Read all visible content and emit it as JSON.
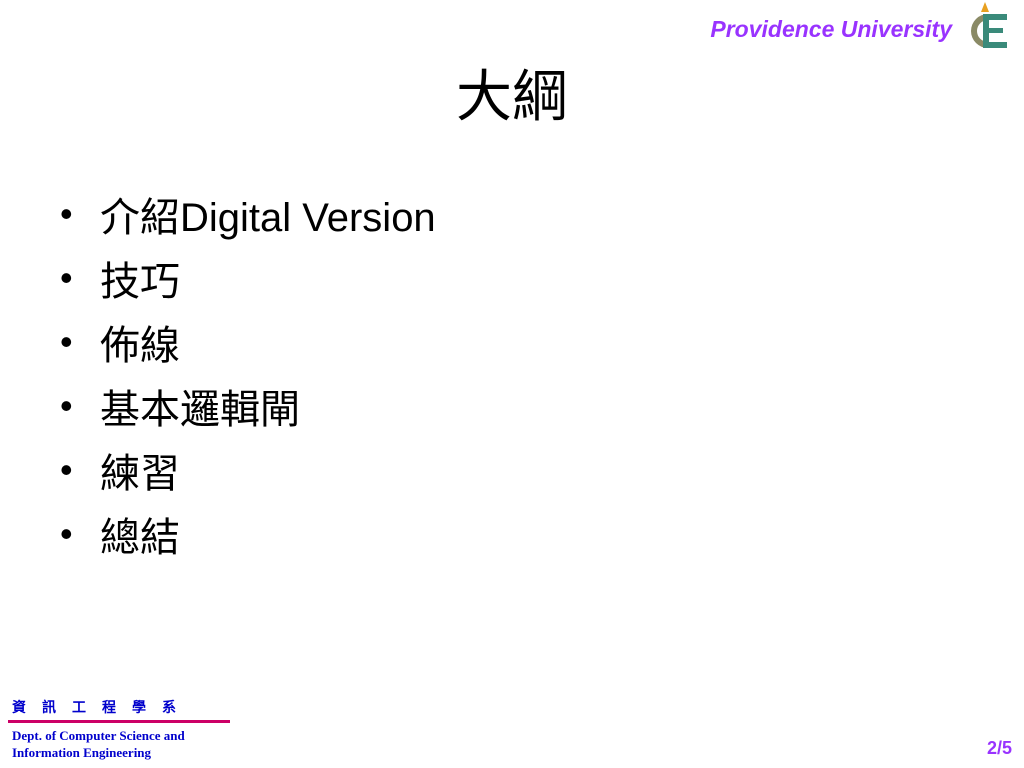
{
  "header": {
    "university": "Providence University",
    "logo_colors": {
      "c_arc": "#8a8a66",
      "e_letter": "#3a8a7a",
      "flame": "#e8a020"
    }
  },
  "title": "大綱",
  "bullets": [
    {
      "marker": "•",
      "text": "介紹Digital Version"
    },
    {
      "marker": "•",
      "text": "技巧"
    },
    {
      "marker": "•",
      "text": "佈線"
    },
    {
      "marker": "•",
      "text": "基本邏輯閘"
    },
    {
      "marker": "•",
      "text": "練習"
    },
    {
      "marker": "•",
      "text": "總結"
    }
  ],
  "footer": {
    "dept_cn": "資　訊　工　程　學　系",
    "dept_en_line1": "Dept. of Computer Science and",
    "dept_en_line2": "Information Engineering",
    "page": "2/5"
  },
  "colors": {
    "accent_purple": "#9933ff",
    "footer_blue": "#0000cc",
    "divider_magenta": "#cc0066"
  }
}
